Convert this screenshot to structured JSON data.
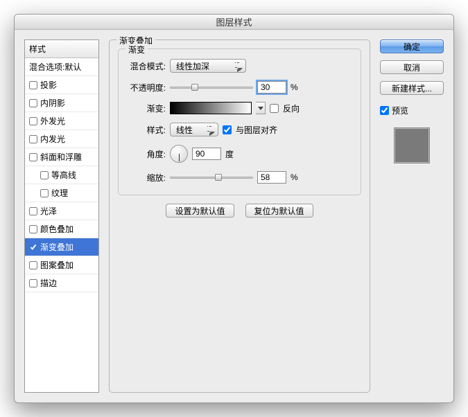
{
  "window": {
    "title": "图层样式"
  },
  "sidebar": {
    "header": "样式",
    "blending": "混合选项:默认",
    "items": [
      {
        "label": "投影",
        "checked": false,
        "selected": false
      },
      {
        "label": "内阴影",
        "checked": false,
        "selected": false
      },
      {
        "label": "外发光",
        "checked": false,
        "selected": false
      },
      {
        "label": "内发光",
        "checked": false,
        "selected": false
      },
      {
        "label": "斜面和浮雕",
        "checked": false,
        "selected": false
      },
      {
        "label": "等高线",
        "checked": false,
        "selected": false,
        "indent": true
      },
      {
        "label": "纹理",
        "checked": false,
        "selected": false,
        "indent": true
      },
      {
        "label": "光泽",
        "checked": false,
        "selected": false
      },
      {
        "label": "颜色叠加",
        "checked": false,
        "selected": false
      },
      {
        "label": "渐变叠加",
        "checked": true,
        "selected": true
      },
      {
        "label": "图案叠加",
        "checked": false,
        "selected": false
      },
      {
        "label": "描边",
        "checked": false,
        "selected": false
      }
    ]
  },
  "panel": {
    "group_title": "渐变叠加",
    "inner_title": "渐变",
    "blend_mode": {
      "label": "混合模式:",
      "value": "线性加深"
    },
    "opacity": {
      "label": "不透明度:",
      "value": "30",
      "unit": "%",
      "slider_pct": 30
    },
    "gradient": {
      "label": "渐变:",
      "reverse_label": "反向",
      "reverse_checked": false
    },
    "style": {
      "label": "样式:",
      "value": "线性",
      "align_label": "与图层对齐",
      "align_checked": true
    },
    "angle": {
      "label": "角度:",
      "value": "90",
      "unit": "度"
    },
    "scale": {
      "label": "缩放:",
      "value": "58",
      "unit": "%",
      "slider_pct": 58
    },
    "set_default": "设置为默认值",
    "reset_default": "复位为默认值"
  },
  "right": {
    "ok": "确定",
    "cancel": "取消",
    "new_style": "新建样式...",
    "preview_label": "预览",
    "preview_checked": true
  }
}
